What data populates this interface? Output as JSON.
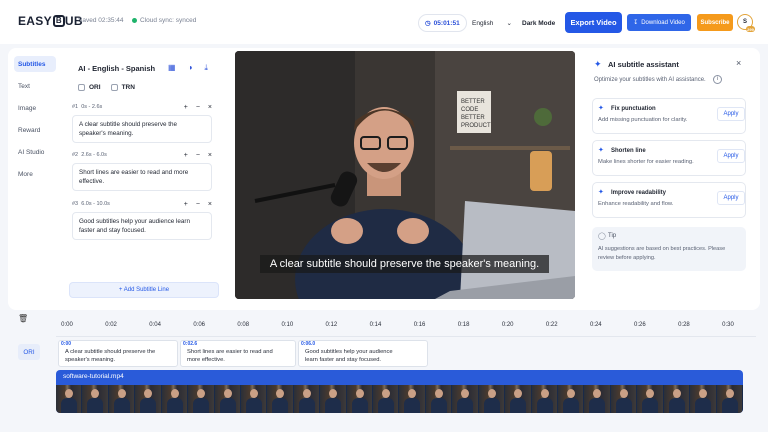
{
  "app": {
    "logo_text": "EASY",
    "logo_glyph": "B",
    "logo_tail": "UB",
    "saved": "Saved 02:35:44",
    "sync": "Cloud sync: synced"
  },
  "header": {
    "timer": "05:01:51",
    "language": "English",
    "dark_mode": "Dark Mode",
    "export": "Export Video",
    "download": "Download Video",
    "subscribe": "Subscribe",
    "avatar": "S",
    "avatar_badge": "299"
  },
  "nav": {
    "items": [
      "Subtitles",
      "Text",
      "Image",
      "Reward",
      "AI Studio",
      "More"
    ]
  },
  "subtitles": {
    "title": "AI - English - Spanish",
    "toggle_ori": "ORI",
    "toggle_trn": "TRN",
    "cues": [
      {
        "index": "#1",
        "time": "0s - 2.6s",
        "text": "A clear subtitle should preserve the speaker's meaning."
      },
      {
        "index": "#2",
        "time": "2.6s - 6.0s",
        "text": "Short lines are easier to read and more effective."
      },
      {
        "index": "#3",
        "time": "6.0s - 10.0s",
        "text": "Good subtitles help your audience learn faster and stay focused."
      }
    ],
    "add_line": "+ Add Subtitle Line"
  },
  "video": {
    "caption": "A clear subtitle should preserve the speaker's meaning.",
    "poster_text": [
      "BETTER",
      "CODE",
      "BETTER",
      "PRODUCT"
    ]
  },
  "assistant": {
    "title": "AI subtitle assistant",
    "subtitle": "Optimize your subtitles with AI assistance.",
    "suggestions": [
      {
        "title": "Fix punctuation",
        "desc": "Add missing punctuation for clarity.",
        "action": "Apply"
      },
      {
        "title": "Shorten line",
        "desc": "Make lines shorter for easier reading.",
        "action": "Apply"
      },
      {
        "title": "Improve readability",
        "desc": "Enhance readability and flow.",
        "action": "Apply"
      }
    ],
    "tip_title": "Tip",
    "tip_text": "AI suggestions are based on best practices. Please review before applying."
  },
  "timeline": {
    "ticks": [
      "0:00",
      "0:02",
      "0:04",
      "0:06",
      "0:08",
      "0:10",
      "0:12",
      "0:14",
      "0:16",
      "0:18",
      "0:20",
      "0:22",
      "0:24",
      "0:26",
      "0:28",
      "0:30"
    ],
    "track_label": "ORI",
    "clips": [
      {
        "start": "0:00",
        "text": "A clear subtitle should preserve the speaker's meaning."
      },
      {
        "start": "0:02.6",
        "text": "Short lines are easier to read and more effective."
      },
      {
        "start": "0:06.0",
        "text": "Good subtitles help your audience learn faster and stay focused."
      }
    ],
    "video_track": "software-tutorial.mp4"
  },
  "colors": {
    "accent": "#2458e6",
    "subscribe": "#f59a1b",
    "track": "#2a5bd9",
    "sync_ok": "#1fb36b"
  }
}
